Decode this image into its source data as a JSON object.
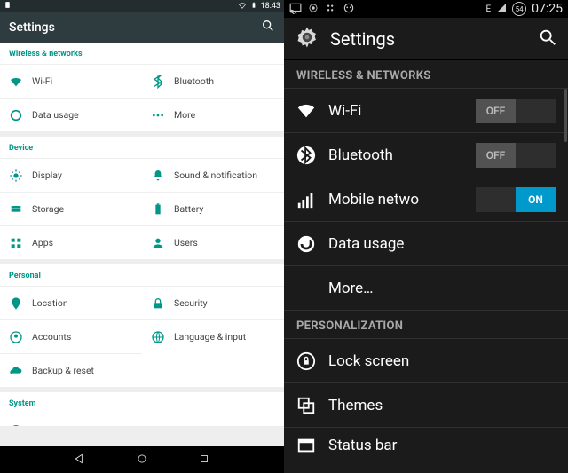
{
  "left": {
    "status": {
      "time": "18:43"
    },
    "appbar": {
      "title": "Settings"
    },
    "sections": {
      "wireless": {
        "header": "Wireless & networks",
        "wifi": "Wi-Fi",
        "bluetooth": "Bluetooth",
        "data": "Data usage",
        "more": "More"
      },
      "device": {
        "header": "Device",
        "display": "Display",
        "sound": "Sound & notification",
        "storage": "Storage",
        "battery": "Battery",
        "apps": "Apps",
        "users": "Users"
      },
      "personal": {
        "header": "Personal",
        "location": "Location",
        "security": "Security",
        "accounts": "Accounts",
        "language": "Language & input",
        "backup": "Backup & reset"
      },
      "system": {
        "header": "System"
      }
    }
  },
  "right": {
    "status": {
      "net": "E",
      "battery": "54",
      "time": "07:25"
    },
    "appbar": {
      "title": "Settings"
    },
    "sections": {
      "wireless": {
        "header": "WIRELESS & NETWORKS",
        "wifi": {
          "label": "Wi-Fi",
          "state": "OFF"
        },
        "bluetooth": {
          "label": "Bluetooth",
          "state": "OFF"
        },
        "mobile": {
          "label": "Mobile netwo",
          "state": "ON"
        },
        "data": {
          "label": "Data usage"
        },
        "more": {
          "label": "More…"
        }
      },
      "personalization": {
        "header": "PERSONALIZATION",
        "lock": "Lock screen",
        "themes": "Themes",
        "statusbar": "Status bar"
      }
    }
  }
}
